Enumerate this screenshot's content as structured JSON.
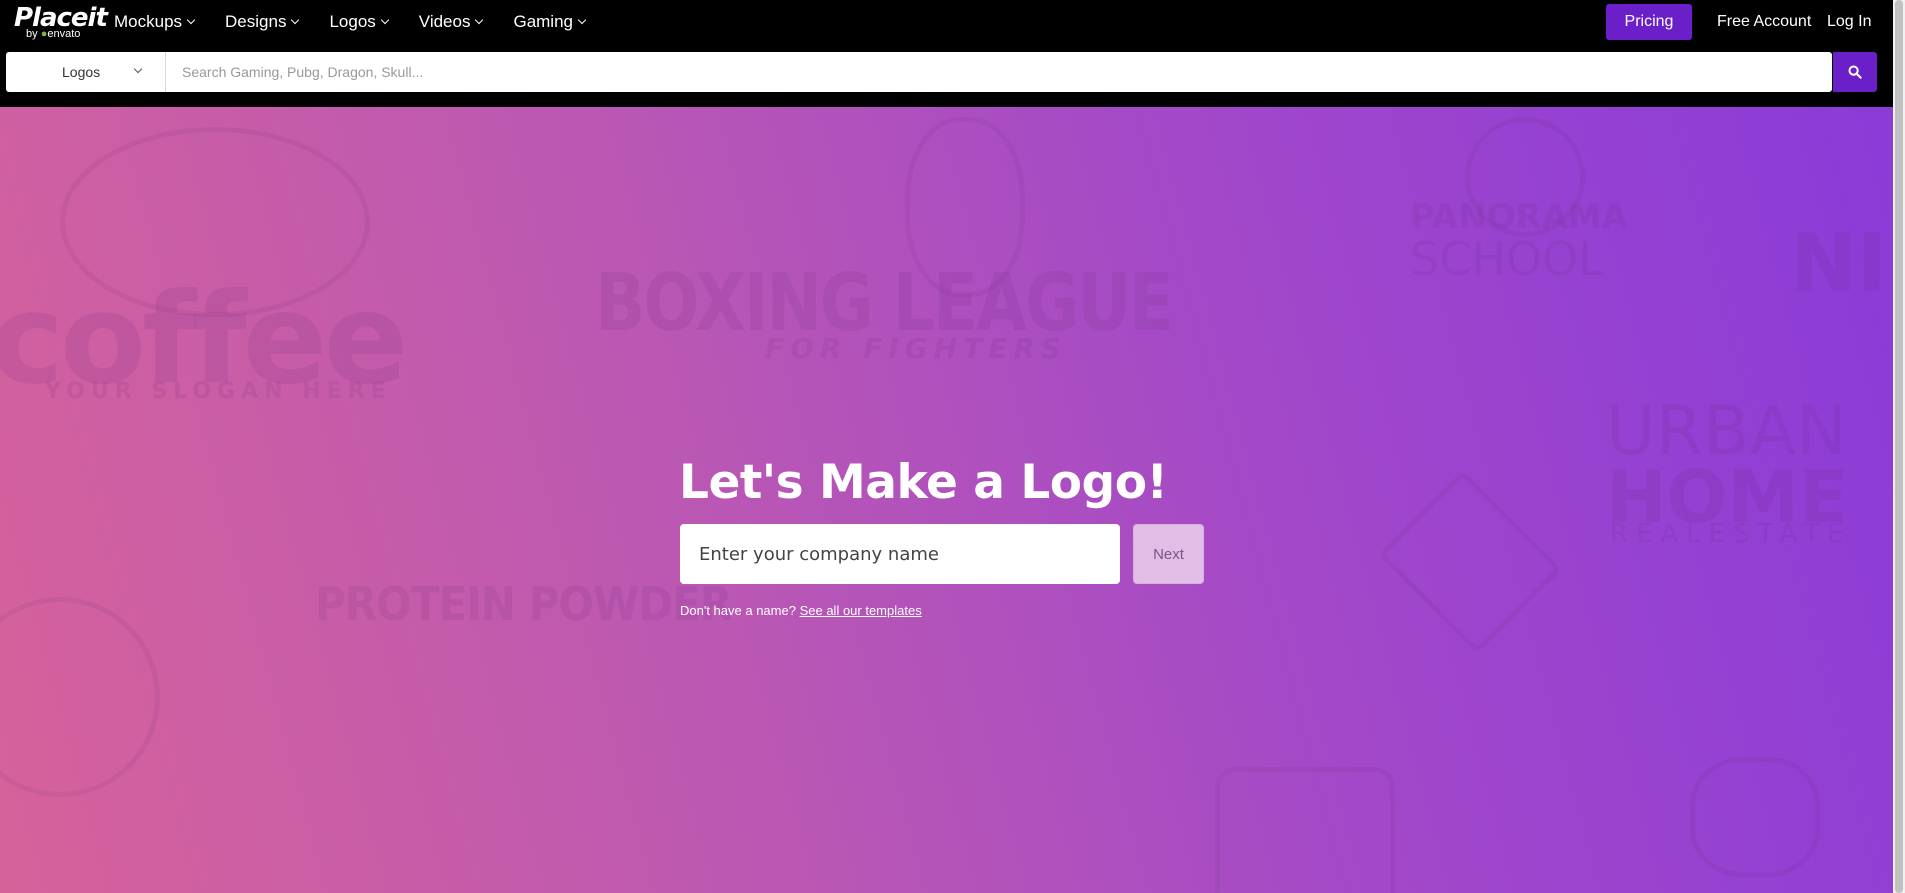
{
  "brand": {
    "name": "Placeit",
    "sub_prefix": "by",
    "sub_name": "envato"
  },
  "nav": [
    {
      "label": "Mockups"
    },
    {
      "label": "Designs"
    },
    {
      "label": "Logos"
    },
    {
      "label": "Videos"
    },
    {
      "label": "Gaming"
    }
  ],
  "account": {
    "pricing_label": "Pricing",
    "free_account_label": "Free Account",
    "login_label": "Log In"
  },
  "search": {
    "category": "Logos",
    "placeholder": "Search Gaming, Pubg, Dragon, Skull..."
  },
  "hero": {
    "headline": "Let's Make a Logo!",
    "company_placeholder": "Enter your company name",
    "next_label": "Next",
    "hint_text": "Don't have a name?",
    "hint_link": "See all our templates"
  },
  "background_logos": {
    "coffee": "coffee",
    "coffee_slogan": "YOUR SLOGAN HERE",
    "boxing": "BOXING LEAGUE",
    "boxing_sub": "FOR FIGHTERS",
    "panorama": "PANORAMA",
    "school": "SCHOOL",
    "urban": "URBAN",
    "home": "HOME",
    "realestate": "REALESTATE",
    "protein": "PROTEIN POWDER",
    "ni": "NI"
  },
  "colors": {
    "accent": "#6b1fc9",
    "gradient_start": "#d6629a",
    "gradient_end": "#8a3bd8"
  },
  "icons": {
    "search": "search-icon",
    "dropdown": "chevron-down-icon"
  }
}
